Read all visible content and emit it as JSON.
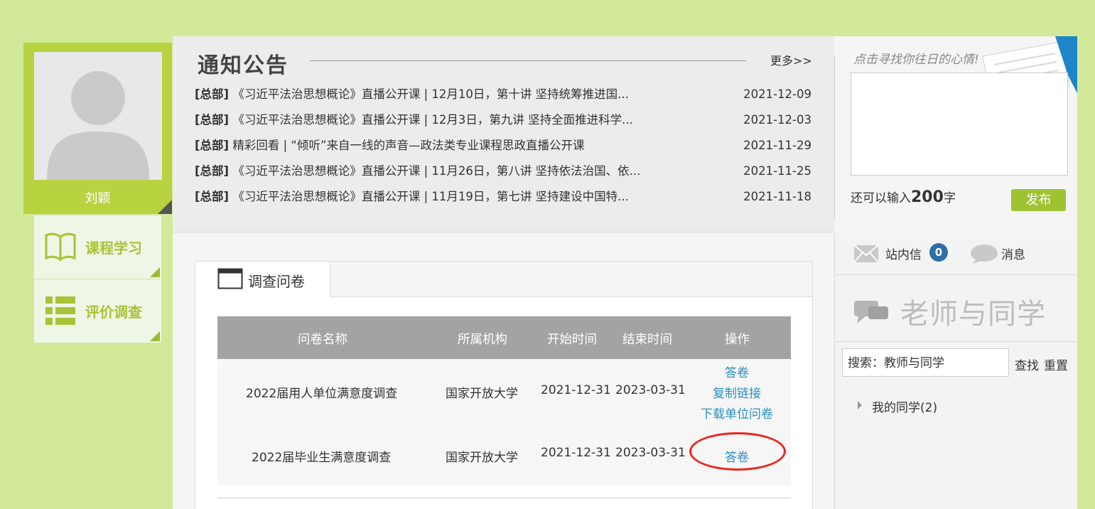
{
  "profile": {
    "name": "刘颖"
  },
  "left_menu": [
    {
      "label": "课程学习"
    },
    {
      "label": "评价调查"
    }
  ],
  "notice": {
    "title": "通知公告",
    "more": "更多>>",
    "items": [
      {
        "tag": "[总部]",
        "title": "《习近平法治思想概论》直播公开课 | 12月10日，第十讲 坚持统筹推进国...",
        "date": "2021-12-09"
      },
      {
        "tag": "[总部]",
        "title": "《习近平法治思想概论》直播公开课 | 12月3日，第九讲 坚持全面推进科学...",
        "date": "2021-12-03"
      },
      {
        "tag": "[总部]",
        "title": "精彩回看 | “倾听”来自一线的声音—政法类专业课程思政直播公开课",
        "date": "2021-11-29"
      },
      {
        "tag": "[总部]",
        "title": "《习近平法治思想概论》直播公开课 | 11月26日，第八讲 坚持依法治国、依...",
        "date": "2021-11-25"
      },
      {
        "tag": "[总部]",
        "title": "《习近平法治思想概论》直播公开课 | 11月19日，第七讲 坚持建设中国特...",
        "date": "2021-11-18"
      }
    ]
  },
  "mood": {
    "header": "点击寻找你往日的心情!",
    "count_prefix": "还可以输入",
    "count": "200",
    "count_suffix": "字",
    "publish": "发布"
  },
  "side": {
    "mail_label": "站内信",
    "mail_count": "0",
    "message_label": "消息",
    "teachers_title": "老师与同学",
    "search_value": "搜索：教师与同学",
    "find": "查找",
    "reset": "重置",
    "classmates": "我的同学(2)"
  },
  "survey": {
    "tab_label": "调查问卷",
    "columns": [
      "问卷名称",
      "所属机构",
      "开始时间",
      "结束时间",
      "操作"
    ],
    "rows": [
      {
        "name": "2022届用人单位满意度调查",
        "org": "国家开放大学",
        "start": "2021-12-31",
        "end": "2023-03-31",
        "actions": [
          "答卷",
          "复制链接",
          "下载单位问卷"
        ]
      },
      {
        "name": "2022届毕业生满意度调查",
        "org": "国家开放大学",
        "start": "2021-12-31",
        "end": "2023-03-31",
        "actions": [
          "答卷"
        ]
      }
    ]
  },
  "colors": {
    "page_bg": "#d2e99a",
    "accent_green": "#b7d33f",
    "link_blue": "#2a8fbf",
    "highlight_red": "#e8281f"
  }
}
